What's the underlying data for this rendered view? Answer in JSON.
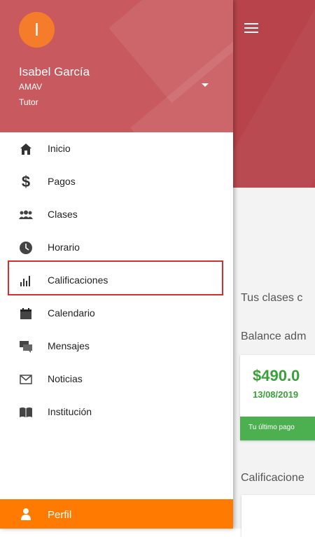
{
  "user": {
    "initial": "I",
    "name": "Isabel García",
    "organization": "AMAV",
    "role": "Tutor"
  },
  "menu": {
    "items": [
      {
        "label": "Inicio",
        "icon": "home-icon"
      },
      {
        "label": "Pagos",
        "icon": "dollar-icon"
      },
      {
        "label": "Clases",
        "icon": "group-icon"
      },
      {
        "label": "Horario",
        "icon": "clock-icon"
      },
      {
        "label": "Calificaciones",
        "icon": "bar-chart-icon",
        "highlighted": true
      },
      {
        "label": "Calendario",
        "icon": "calendar-icon"
      },
      {
        "label": "Mensajes",
        "icon": "chat-icon"
      },
      {
        "label": "Noticias",
        "icon": "mail-icon"
      },
      {
        "label": "Institución",
        "icon": "book-icon"
      }
    ],
    "footer": {
      "label": "Perfil",
      "icon": "user-icon"
    }
  },
  "background": {
    "classes_text": "Tus clases c",
    "balance_text": "Balance adm",
    "amount": "$490.0",
    "date": "13/08/2019",
    "last_payment": "Tu último pago",
    "grades_text": "Calificacione"
  },
  "colors": {
    "header": "#c85a5f",
    "accent": "#ff7a00",
    "avatar": "#f57c2a",
    "highlight_border": "#d32f2f",
    "success": "#4caf50"
  }
}
